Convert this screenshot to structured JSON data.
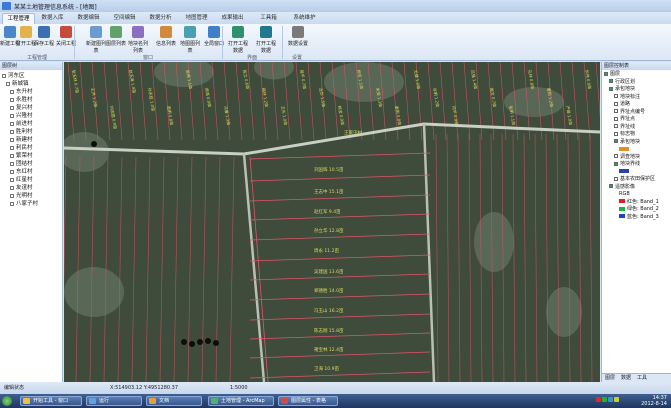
{
  "window": {
    "title": "某某土地管理信息系统 - [地图]"
  },
  "tabs": [
    {
      "label": "工程管理",
      "active": true
    },
    {
      "label": "数据入库"
    },
    {
      "label": "数据编辑"
    },
    {
      "label": "空间编辑"
    },
    {
      "label": "数据分析"
    },
    {
      "label": "地图管理"
    },
    {
      "label": "成果输出"
    },
    {
      "label": "工具箱"
    },
    {
      "label": "系统维护"
    }
  ],
  "ribbon": {
    "buttons": [
      {
        "label": "新建工程",
        "icon": "new-project-icon",
        "color": "#4a86c8"
      },
      {
        "label": "打开工程",
        "icon": "open-folder-icon",
        "color": "#e2b34a"
      },
      {
        "label": "保存工程",
        "icon": "save-icon",
        "color": "#3a6fb5"
      },
      {
        "label": "关闭工程",
        "icon": "close-project-icon",
        "color": "#c64b3a"
      },
      {
        "label": "新建图列表",
        "icon": "list-icon",
        "color": "#6a9bd1"
      },
      {
        "label": "图层列表",
        "icon": "layers-icon",
        "color": "#5fa36a"
      },
      {
        "label": "地块名列列表",
        "icon": "table-icon",
        "color": "#8b6fc2"
      },
      {
        "label": "信息列表",
        "icon": "info-icon",
        "color": "#d28a3a"
      },
      {
        "label": "地图图列表",
        "icon": "map-list-icon",
        "color": "#4a9fb1"
      },
      {
        "label": "全局窗口",
        "icon": "globe-icon",
        "color": "#3e7fc8"
      },
      {
        "label": "打开工程数据",
        "icon": "open-data-icon",
        "color": "#2f8f6f"
      },
      {
        "label": "打开工程数据",
        "icon": "cursor-icon",
        "color": "#1f7a8f"
      },
      {
        "label": "数据设置",
        "icon": "settings-icon",
        "color": "#7a7a7a"
      }
    ],
    "groups": [
      "工程管理",
      "窗口",
      "界面",
      "设置"
    ]
  },
  "left_panel": {
    "title": "图层树",
    "root": "河东区",
    "group": "新城镇",
    "villages": [
      "东升村",
      "永胜村",
      "复兴村",
      "兴隆村",
      "前进村",
      "胜利村",
      "新建村",
      "利民村",
      "繁荣村",
      "团结村",
      "东红村",
      "红星村",
      "友谊村",
      "光明村",
      "八家子村"
    ]
  },
  "right_panel": {
    "title": "图层控制表",
    "layers": [
      {
        "label": "图层",
        "checked": true,
        "level": 0
      },
      {
        "label": "行政区划",
        "checked": true,
        "level": 1
      },
      {
        "label": "承包地块",
        "checked": true,
        "level": 1
      },
      {
        "label": "地块标注",
        "checked": false,
        "level": 2
      },
      {
        "label": "道路",
        "checked": false,
        "level": 2
      },
      {
        "label": "界址点编号",
        "checked": false,
        "level": 2
      },
      {
        "label": "界址点",
        "checked": false,
        "level": 2
      },
      {
        "label": "界址线",
        "checked": false,
        "level": 2
      },
      {
        "label": "标志物",
        "checked": false,
        "level": 2
      },
      {
        "label": "承包地块",
        "checked": true,
        "level": 2
      },
      {
        "label": "",
        "swatch": "#e48b2a",
        "level": 3
      },
      {
        "label": "调查地块",
        "checked": false,
        "level": 2
      },
      {
        "label": "地块界线",
        "checked": true,
        "level": 2
      },
      {
        "label": "",
        "swatch": "#2a3fb0",
        "level": 3
      },
      {
        "label": "基本农田保护区",
        "checked": false,
        "level": 2
      },
      {
        "label": "遥感影像",
        "checked": true,
        "level": 1
      },
      {
        "label": "RGB",
        "level": 3
      },
      {
        "label": "红色: Band_1",
        "swatch": "#e02020",
        "level": 3
      },
      {
        "label": "绿色: Band_2",
        "swatch": "#20b040",
        "level": 3
      },
      {
        "label": "蓝色: Band_3",
        "swatch": "#2040d0",
        "level": 3
      }
    ],
    "tabs": [
      "图层",
      "数据",
      "工具"
    ]
  },
  "map": {
    "top_labels": [
      "张玉林 0.7亩",
      "王洪 1.2亩",
      "刘志国 0.9亩",
      "赵玉海 1.4亩",
      "孙永胜 1.0亩",
      "周明 0.8亩",
      "吴德 1.1亩",
      "郑海 0.9亩",
      "冯春 1.3亩",
      "陈立 0.6亩",
      "褚林 1.2亩",
      "卫东 1.0亩",
      "蒋平 0.7亩",
      "沈华 1.5亩",
      "韩宝 0.9亩",
      "杨军 1.1亩",
      "朱亮 1.3亩",
      "秦刚 0.8亩",
      "尤健 1.0亩",
      "许明 1.2亩",
      "何平 0.9亩",
      "吕强 1.4亩",
      "施文 0.7亩",
      "张明 1.1亩",
      "孔林 0.8亩",
      "曹阳 1.2亩",
      "严峰 1.0亩",
      "华伟 0.9亩"
    ],
    "center_parcels": [
      "刘国辉 10.5亩",
      "王志中 15.1亩",
      "赵红军 9.4亩",
      "孙立华 12.8亩",
      "周永 11.2亩",
      "吴建国 13.6亩",
      "郑德胜 14.0亩",
      "冯玉山 16.2亩",
      "陈志刚 15.8亩",
      "褚宝林 12.4亩",
      "卫海 10.9亩"
    ],
    "road_label": "王家屯村"
  },
  "status": {
    "left": "编辑状态",
    "coords": "X:514903.12  Y:4951280.37",
    "scale": "1:5000"
  },
  "taskbar": {
    "items": [
      "开始工具 - 窗口",
      "运行",
      "文档",
      "土地管理 - ArcMap",
      "图层属性 - 表格"
    ],
    "time": "14:37",
    "date": "2012-8-14"
  }
}
